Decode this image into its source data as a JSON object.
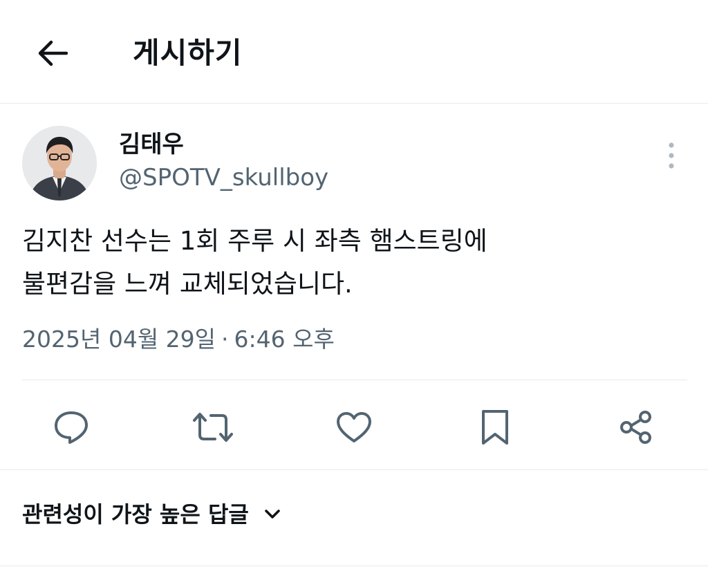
{
  "header": {
    "back_icon": "arrow-left-icon",
    "title": "게시하기"
  },
  "author": {
    "name": "김태우",
    "handle": "@SPOTV_skullboy",
    "avatar_icon": "profile-photo"
  },
  "tweet": {
    "text_lines": [
      "김지찬 선수는 1회 주루 시 좌측 햄스트링에",
      "불편감을 느껴 교체되었습니다."
    ],
    "date": "2025년 04월 29일",
    "separator": "·",
    "time": "6:46 오후"
  },
  "actions": [
    {
      "name": "reply",
      "icon": "speech-bubble-icon"
    },
    {
      "name": "retweet",
      "icon": "retweet-icon"
    },
    {
      "name": "like",
      "icon": "heart-icon"
    },
    {
      "name": "bookmark",
      "icon": "bookmark-icon"
    },
    {
      "name": "share",
      "icon": "share-icon"
    }
  ],
  "replies_sort": {
    "label": "관련성이 가장 높은 답글",
    "icon": "chevron-down-icon"
  },
  "colors": {
    "text_primary": "#0f1419",
    "text_secondary": "#536471",
    "divider": "#e6e9ec",
    "icon": "#536471"
  }
}
